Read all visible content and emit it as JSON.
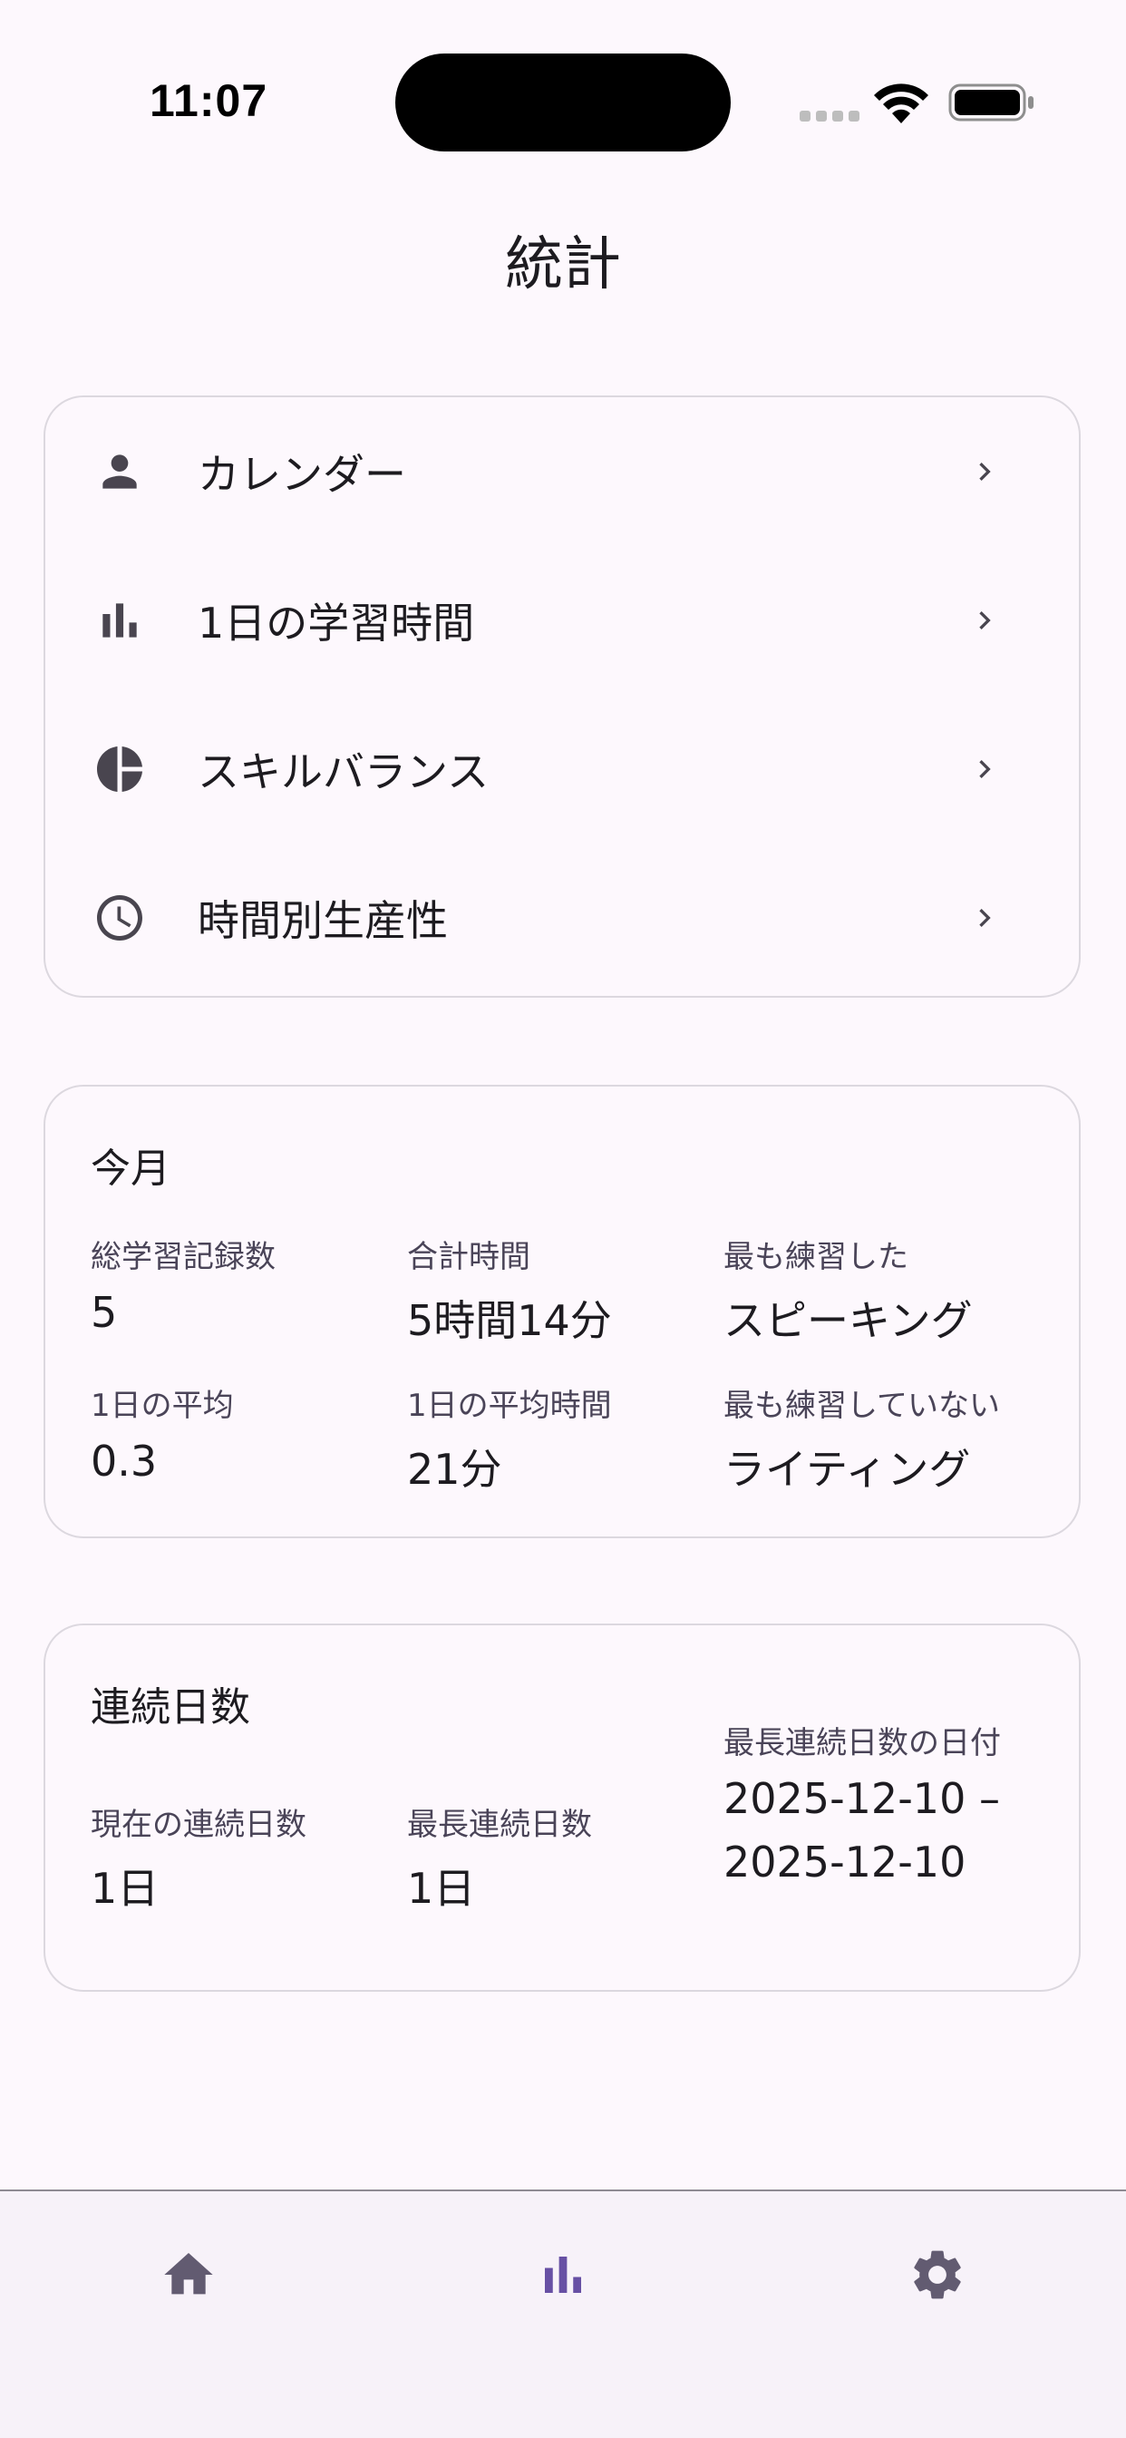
{
  "status_bar": {
    "time": "11:07"
  },
  "header": {
    "title": "統計"
  },
  "menu": {
    "items": [
      {
        "label": "カレンダー",
        "icon": "person-icon"
      },
      {
        "label": "1日の学習時間",
        "icon": "bar-chart-icon"
      },
      {
        "label": "スキルバランス",
        "icon": "pie-chart-icon"
      },
      {
        "label": "時間別生産性",
        "icon": "clock-icon"
      }
    ]
  },
  "this_month": {
    "title": "今月",
    "stats": [
      {
        "label": "総学習記録数",
        "value": "5"
      },
      {
        "label": "合計時間",
        "value": "5時間14分"
      },
      {
        "label": "最も練習した",
        "value": "スピーキング"
      },
      {
        "label": "1日の平均",
        "value": "0.3"
      },
      {
        "label": "1日の平均時間",
        "value": "21分"
      },
      {
        "label": "最も練習していない",
        "value": "ライティング"
      }
    ]
  },
  "streak": {
    "title": "連続日数",
    "current_label": "現在の連続日数",
    "current_value": "1日",
    "longest_label": "最長連続日数",
    "longest_value": "1日",
    "longest_dates_label": "最長連続日数の日付",
    "longest_dates_line1": "2025-12-10 –",
    "longest_dates_line2": "2025-12-10"
  },
  "bottom_nav": {
    "items": [
      "home-icon",
      "bar-chart-icon",
      "gear-icon"
    ],
    "active_index": 1
  },
  "colors": {
    "background": "#fdf8fd",
    "accent": "#6750a4",
    "icon_gray": "#49454f",
    "nav_inactive": "#625b71"
  }
}
